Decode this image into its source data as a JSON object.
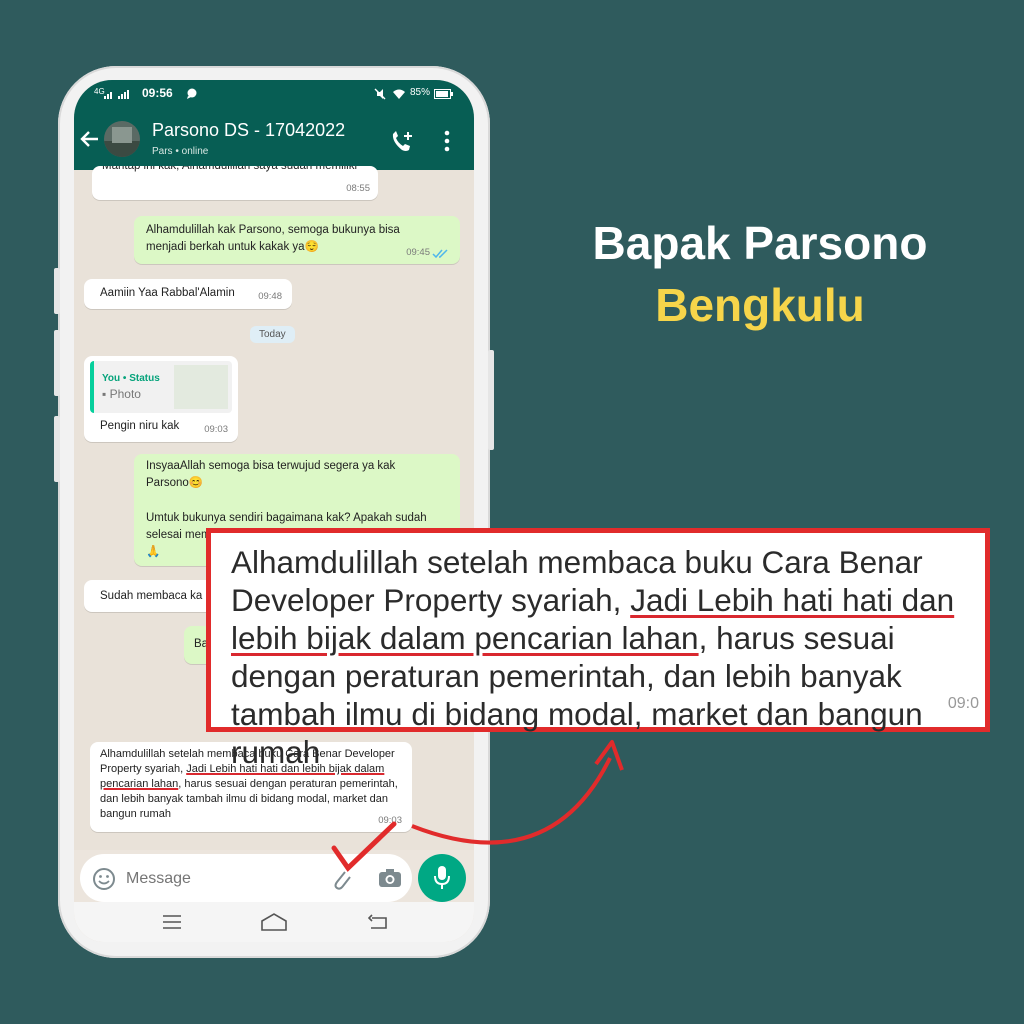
{
  "status_bar": {
    "network": "4G",
    "time": "09:56",
    "battery": "85%"
  },
  "chat_header": {
    "title": "Parsono DS - 17042022",
    "sub_name": "Pars",
    "sub_status": "online"
  },
  "messages": [
    {
      "text": "Mantap ini kak, Alhamdulillah saya sudah memiliki",
      "time": "08:55"
    },
    {
      "text": "Alhamdulillah kak Parsono, semoga bukunya bisa menjadi berkah untuk kakak ya😌",
      "time": "09:45"
    },
    {
      "text": "Aamiin Yaa Rabbal'Alamin",
      "time": "09:48"
    },
    {
      "day": "Today"
    },
    {
      "reply_author": "You • Status",
      "reply_type": "Photo",
      "text": "Pengin niru kak",
      "time": "09:03"
    },
    {
      "text_line1": "InsyaaAllah semoga bisa terwujud segera ya kak Parsono😊",
      "text_line2": "Umtuk bukunya sendiri bagaimana kak? Apakah sudah selesai mem",
      "emoji": "🙏"
    },
    {
      "text": "Sudah membaca ka"
    },
    {
      "text": "Ba"
    },
    {
      "text_part1": "Alhamdulillah setelah membaca buku Cara Benar Developer Property syariah, ",
      "text_underlined": "Jadi Lebih hati hati dan lebih bijak dalam pencarian lahan",
      "text_part2": ", harus sesuai dengan peraturan pemerintah, dan lebih banyak tambah ilmu di bidang modal, market dan bangun rumah",
      "time": "09:03"
    }
  ],
  "input": {
    "placeholder": "Message"
  },
  "headline": {
    "line1": "Bapak Parsono",
    "line2": "Bengkulu"
  },
  "zoom": {
    "part1": "Alhamdulillah setelah membaca buku Cara Benar Developer Property syariah, ",
    "underlined": "Jadi Lebih hati hati dan lebih bijak dalam pencarian lahan",
    "part2": ", harus sesuai dengan peraturan pemerintah, dan lebih banyak tambah ilmu di bidang modal, market dan bangun rumah",
    "time": "09:0"
  },
  "colors": {
    "background": "#2f5b5d",
    "whatsapp_green": "#075e54",
    "accent_red": "#e12b2b",
    "headline_yellow": "#f6d54a"
  }
}
